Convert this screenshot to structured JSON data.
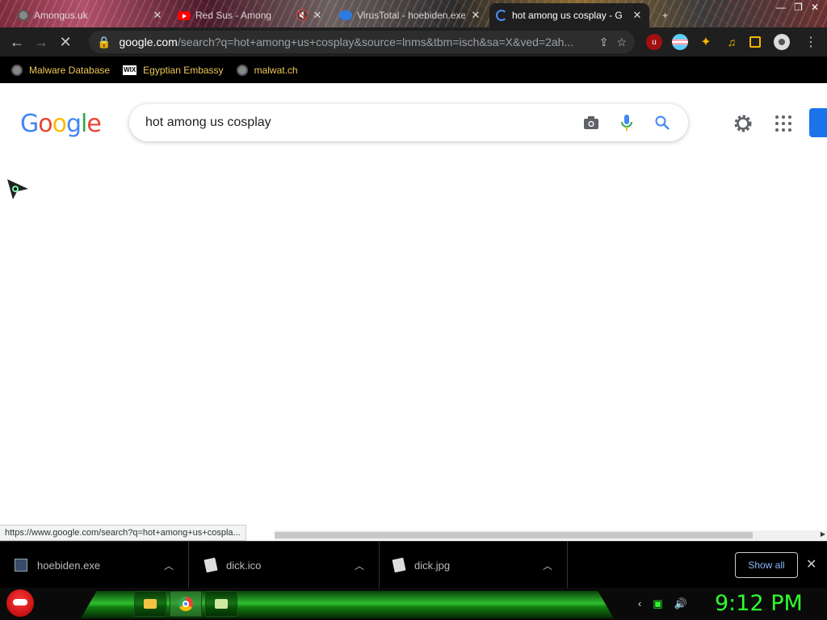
{
  "tabs": [
    {
      "title": "Amongus.uk",
      "icon": "globe-icon"
    },
    {
      "title": "Red Sus - Among",
      "icon": "youtube-icon"
    },
    {
      "title": "VirusTotal - hoebiden.exe",
      "icon": "cloud-icon"
    },
    {
      "title": "hot among us cosplay - G",
      "icon": "loading-spinner-icon",
      "active": true
    }
  ],
  "window_controls": {
    "minimize": "—",
    "restore": "❐",
    "close": "✕"
  },
  "toolbar": {
    "url_host": "google.com",
    "url_path": "/search?q=hot+among+us+cosplay&source=lnms&tbm=isch&sa=X&ved=2ah..."
  },
  "bookmarks": [
    {
      "label": "Malware Database",
      "icon": "globe-icon"
    },
    {
      "label": "Egyptian Embassy",
      "icon": "wix-icon"
    },
    {
      "label": "malwat.ch",
      "icon": "globe-icon"
    }
  ],
  "google": {
    "logo_letters": [
      "G",
      "o",
      "o",
      "g",
      "l",
      "e"
    ],
    "query": "hot among us cosplay"
  },
  "status_url": "https://www.google.com/search?q=hot+among+us+cospla...",
  "downloads": [
    {
      "name": "hoebiden.exe"
    },
    {
      "name": "dick.ico"
    },
    {
      "name": "dick.jpg"
    }
  ],
  "show_all_label": "Show all",
  "clock": "9:12 PM",
  "colors": {
    "accent": "#1a73e8",
    "clock": "#2dff2d",
    "bookmark_text": "#f2c85b"
  }
}
